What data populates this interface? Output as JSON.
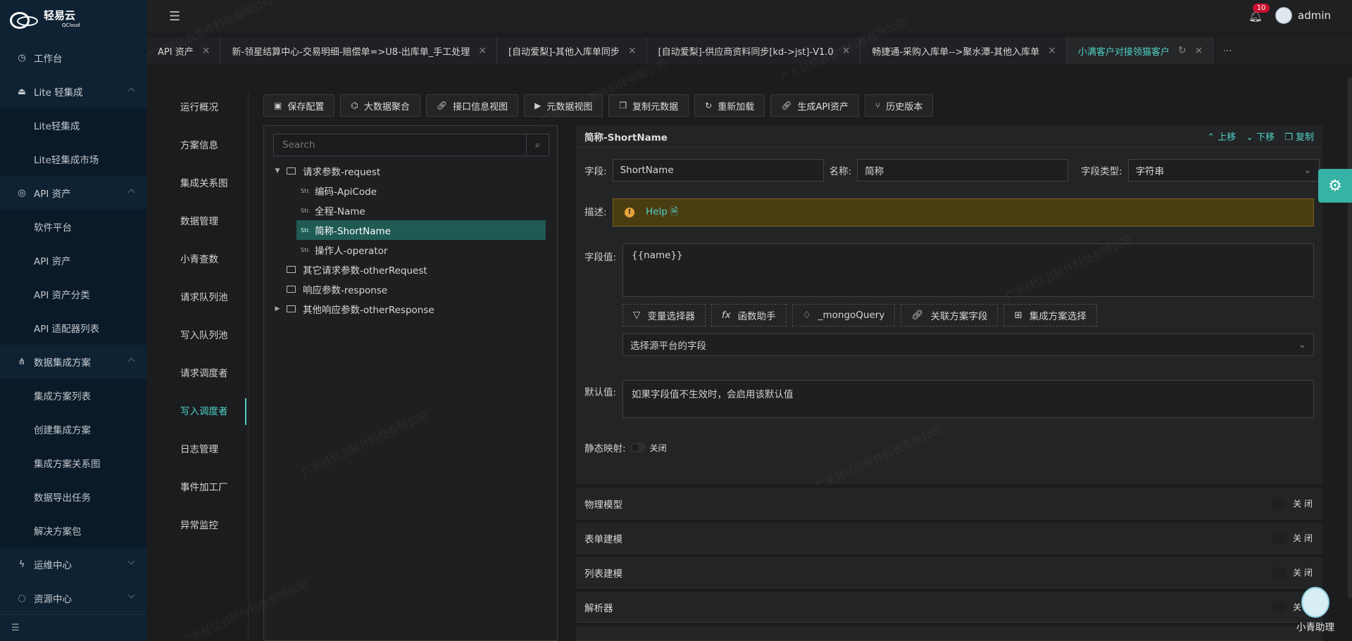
{
  "app": {
    "logo_text": "轻易云",
    "logo_sub": "QCloud"
  },
  "sidebar": {
    "items": [
      {
        "label": "工作台",
        "icon": "clock-icon"
      },
      {
        "label": "Lite 轻集成",
        "icon": "plug-icon",
        "sub": [
          "Lite轻集成",
          "Lite轻集成市场"
        ]
      },
      {
        "label": "API 资产",
        "icon": "compass-icon",
        "sub": [
          "软件平台",
          "API 资产",
          "API 资产分类",
          "API 适配器列表"
        ]
      },
      {
        "label": "数据集成方案",
        "icon": "network-icon",
        "sub": [
          "集成方案列表",
          "创建集成方案",
          "集成方案关系图",
          "数据导出任务",
          "解决方案包"
        ]
      },
      {
        "label": "运维中心",
        "icon": "lightning-icon"
      },
      {
        "label": "资源中心",
        "icon": "resource-icon"
      }
    ]
  },
  "header": {
    "notification_count": "10",
    "username": "admin"
  },
  "tabs": [
    {
      "label": "API 资产",
      "active": false
    },
    {
      "label": "新-领星结算中心-交易明细-赔偿单=>U8-出库单_手工处理",
      "active": false
    },
    {
      "label": "[自动爱梨]-其他入库单同步",
      "active": false
    },
    {
      "label": "[自动爱梨]-供应商资料同步[kd->jst]-V1.0",
      "active": false
    },
    {
      "label": "畅捷通-采购入库单-->聚水潭-其他入库单",
      "active": false
    },
    {
      "label": "小满客户对接领猫客户",
      "active": true
    }
  ],
  "tab_more": "⋯",
  "inner_menu": [
    "运行概况",
    "方案信息",
    "集成关系图",
    "数据管理",
    "小青查数",
    "请求队列池",
    "写入队列池",
    "请求调度者",
    "写入调度者",
    "日志管理",
    "事件加工厂",
    "异常监控"
  ],
  "inner_menu_active": "写入调度者",
  "toolbar": [
    "保存配置",
    "大数据聚合",
    "接口信息视图",
    "元数据视图",
    "复制元数据",
    "重新加载",
    "生成API资产",
    "历史版本"
  ],
  "tree": {
    "search_placeholder": "Search",
    "nodes": [
      {
        "label": "请求参数-request",
        "type": "folder",
        "level": 0,
        "expanded": true
      },
      {
        "label": "编码-ApiCode",
        "type": "str",
        "level": 1
      },
      {
        "label": "全程-Name",
        "type": "str",
        "level": 1
      },
      {
        "label": "简称-ShortName",
        "type": "str",
        "level": 1,
        "selected": true
      },
      {
        "label": "操作人-operator",
        "type": "str",
        "level": 1
      },
      {
        "label": "其它请求参数-otherRequest",
        "type": "folder",
        "level": 0
      },
      {
        "label": "响应参数-response",
        "type": "folder",
        "level": 0
      },
      {
        "label": "其他响应参数-otherResponse",
        "type": "folder",
        "level": 0,
        "collapsed": true
      }
    ],
    "str_tag": "Str."
  },
  "detail": {
    "title": "简称-ShortName",
    "actions": {
      "up": "上移",
      "down": "下移",
      "copy": "复制"
    },
    "field_label": "字段:",
    "field_value": "ShortName",
    "name_label": "名称:",
    "name_value": "简称",
    "type_label": "字段类型:",
    "type_value": "字符串",
    "desc_label": "描述:",
    "help_text": "Help",
    "value_label": "字段值:",
    "value_text": "{{name}}",
    "helpers": [
      "变量选择器",
      "函数助手",
      "_mongoQuery",
      "关联方案字段",
      "集成方案选择"
    ],
    "source_placeholder": "选择源平台的字段",
    "default_label": "默认值:",
    "default_placeholder": "如果字段值不生效时，会启用该默认值",
    "static_label": "静态映射:",
    "static_state": "关闭"
  },
  "sections": [
    {
      "title": "物理模型",
      "state": "关 闭"
    },
    {
      "title": "表单建模",
      "state": "关 闭"
    },
    {
      "title": "列表建模",
      "state": "关 闭"
    },
    {
      "title": "解析器",
      "state": "关 闭"
    }
  ],
  "assistant": {
    "label": "小青助理"
  },
  "watermark": "广东轻亿云软件科技有限公司",
  "colors": {
    "accent": "#4fd1c5",
    "sidebar_bg": "#0f2233",
    "alert_bg": "#4a3d12"
  }
}
